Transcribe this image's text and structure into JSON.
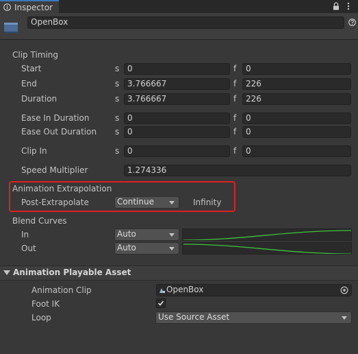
{
  "tab": {
    "title": "Inspector",
    "icon": "info-icon"
  },
  "header": {
    "object_name": "OpenBox",
    "icon": "clip-object-icon"
  },
  "clip_timing": {
    "title": "Clip Timing",
    "sec_unit": "s",
    "frame_unit": "f",
    "rows": [
      {
        "label": "Start",
        "seconds": "0",
        "frames": "0"
      },
      {
        "label": "End",
        "seconds": "3.766667",
        "frames": "226"
      },
      {
        "label": "Duration",
        "seconds": "3.766667",
        "frames": "226"
      },
      {
        "label": "Ease In Duration",
        "seconds": "0",
        "frames": "0"
      },
      {
        "label": "Ease Out Duration",
        "seconds": "0",
        "frames": "0"
      },
      {
        "label": "Clip In",
        "seconds": "0",
        "frames": "0"
      }
    ],
    "speed_label": "Speed Multiplier",
    "speed_value": "1.274336"
  },
  "extrapolation": {
    "title": "Animation Extrapolation",
    "post_label": "Post-Extrapolate",
    "post_value": "Continue",
    "post_info": "Infinity",
    "highlight_color": "#e02020"
  },
  "blend_curves": {
    "title": "Blend Curves",
    "in_label": "In",
    "in_value": "Auto",
    "out_label": "Out",
    "out_value": "Auto",
    "curve_color": "#3ec43e"
  },
  "playable_asset": {
    "title": "Animation Playable Asset",
    "clip_label": "Animation Clip",
    "clip_value": "OpenBox",
    "foot_ik_label": "Foot IK",
    "foot_ik_checked": true,
    "loop_label": "Loop",
    "loop_value": "Use Source Asset"
  }
}
